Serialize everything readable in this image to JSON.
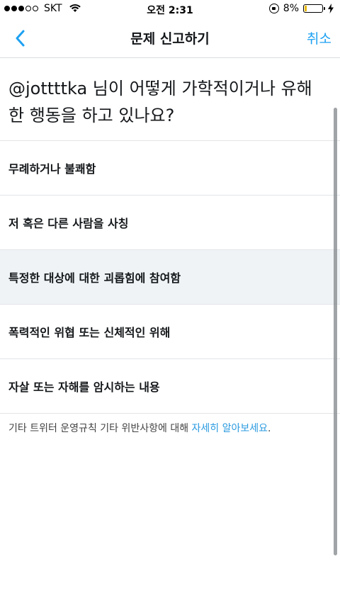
{
  "status_bar": {
    "carrier": "SKT",
    "time": "오전 2:31",
    "battery": "8%"
  },
  "nav": {
    "title": "문제 신고하기",
    "cancel_label": "취소"
  },
  "question": "@jottttka 님이 어떻게 가학적이거나 유해한 행동을 하고 있나요?",
  "options": [
    "무례하거나 불쾌함",
    "저 혹은 다른 사람을 사칭",
    "특정한 대상에 대한 괴롭힘에 참여함",
    "폭력적인 위협 또는 신체적인 위해",
    "자살 또는 자해를 암시하는 내용"
  ],
  "footer": {
    "text": "기타 트위터 운영규칙 기타 위반사항에 대해 ",
    "link": "자세히 알아보세요",
    "suffix": "."
  },
  "colors": {
    "accent": "#1da1f2",
    "highlight_row": "#f0f3f6"
  }
}
